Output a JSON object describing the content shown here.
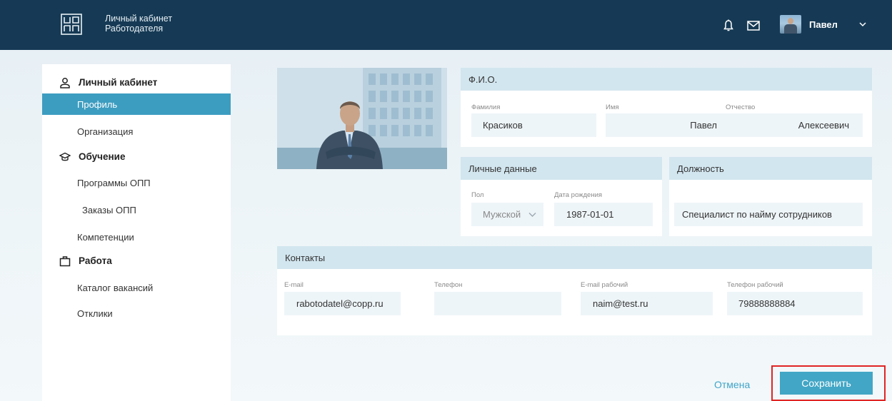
{
  "header": {
    "title_line1": "Личный кабинет",
    "title_line2": "Работодателя",
    "user_name": "Павел"
  },
  "sidebar": {
    "sections": [
      {
        "label": "Личный кабинет",
        "icon": "user-icon"
      },
      {
        "label": "Обучение",
        "icon": "graduation-cap-icon"
      },
      {
        "label": "Работа",
        "icon": "briefcase-icon"
      }
    ],
    "items": [
      {
        "label": "Профиль",
        "active": true
      },
      {
        "label": "Организация"
      },
      {
        "label": "Программы ОПП"
      },
      {
        "label": "Заказы ОПП"
      },
      {
        "label": "Компетенции"
      },
      {
        "label": "Каталог вакансий"
      },
      {
        "label": "Отклики"
      }
    ]
  },
  "fio": {
    "title": "Ф.И.О.",
    "last_name_label": "Фамилия",
    "last_name": "Красиков",
    "first_name_label": "Имя",
    "first_name": "Павел",
    "middle_name_label": "Отчество",
    "middle_name": "Алексеевич"
  },
  "personal": {
    "title": "Личные данные",
    "gender_label": "Пол",
    "gender": "Мужской",
    "birth_label": "Дата рождения",
    "birth_date": "1987-01-01"
  },
  "position": {
    "title": "Должность",
    "value": "Специалист по найму сотрудников"
  },
  "contacts": {
    "title": "Контакты",
    "email_label": "E-mail",
    "email": "rabotodatel@copp.ru",
    "phone_label": "Телефон",
    "phone": "",
    "work_email_label": "E-mail рабочий",
    "work_email": "naim@test.ru",
    "work_phone_label": "Телефон рабочий",
    "work_phone": "79888888884"
  },
  "actions": {
    "cancel": "Отмена",
    "save": "Сохранить"
  },
  "colors": {
    "header_bg": "#163a55",
    "accent": "#42a6c6",
    "card_header": "#d2e6ef",
    "highlight": "#e02424"
  }
}
